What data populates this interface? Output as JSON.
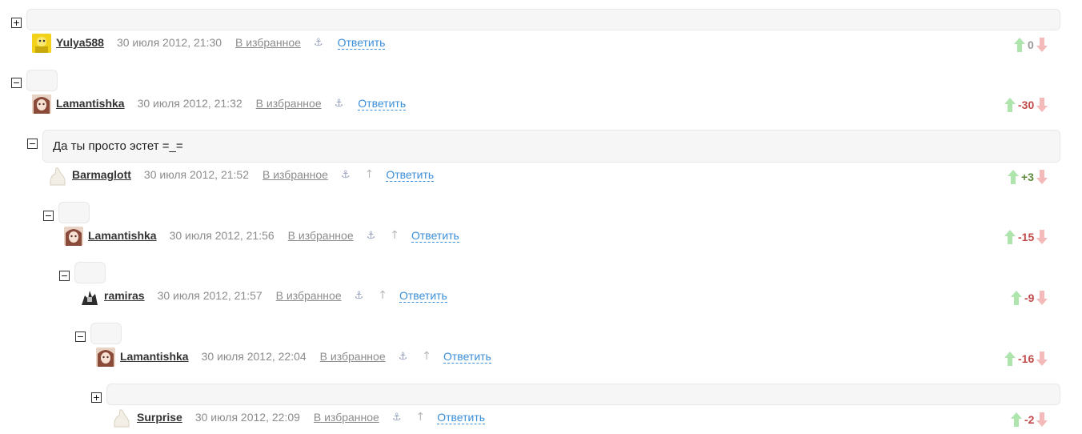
{
  "ui": {
    "fav_label": "В избранное",
    "reply_label": "Ответить",
    "anchor_glyph": "⚓",
    "parent_glyph": "↑"
  },
  "colors": {
    "vote_up": "#aee5ad",
    "vote_down": "#f4b9b9",
    "negative": "#c24a4a",
    "positive": "#5d8a3a",
    "link": "#3b8ed8"
  },
  "comments": [
    {
      "toggle": "+",
      "text": "",
      "user": "Yulya588",
      "date": "30 июля 2012, 21:30",
      "score": "0",
      "avatar": "yellow-character-avatar",
      "parent_link": false
    },
    {
      "toggle": "−",
      "text": "",
      "user": "Lamantishka",
      "date": "30 июля 2012, 21:32",
      "score": "-30",
      "avatar": "anime-girl-avatar",
      "parent_link": false
    },
    {
      "toggle": "−",
      "text": "Да ты просто эстет =_=",
      "user": "Barmaglott",
      "date": "30 июля 2012, 21:52",
      "score": "+3",
      "avatar": "default-avatar",
      "parent_link": true
    },
    {
      "toggle": "−",
      "text": "",
      "user": "Lamantishka",
      "date": "30 июля 2012, 21:56",
      "score": "-15",
      "avatar": "anime-girl-avatar",
      "parent_link": true
    },
    {
      "toggle": "−",
      "text": "",
      "user": "ramiras",
      "date": "30 июля 2012, 21:57",
      "score": "-9",
      "avatar": "dark-figure-avatar",
      "parent_link": true
    },
    {
      "toggle": "−",
      "text": "",
      "user": "Lamantishka",
      "date": "30 июля 2012, 22:04",
      "score": "-16",
      "avatar": "anime-girl-avatar",
      "parent_link": true
    },
    {
      "toggle": "+",
      "text": "",
      "user": "Surprise",
      "date": "30 июля 2012, 22:09",
      "score": "-2",
      "avatar": "default-avatar",
      "parent_link": true
    }
  ]
}
